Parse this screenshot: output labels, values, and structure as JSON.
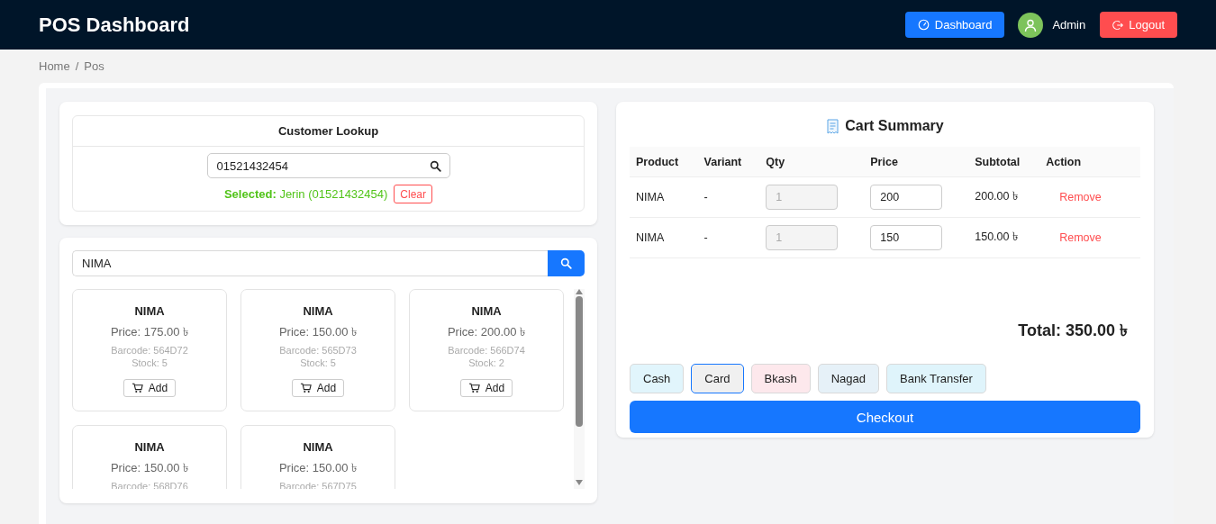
{
  "header": {
    "title": "POS Dashboard",
    "dashboard_button": "Dashboard",
    "user": "Admin",
    "logout_button": "Logout"
  },
  "breadcrumb": {
    "items": [
      "Home",
      "Pos"
    ],
    "separator": "/"
  },
  "customer_lookup": {
    "title": "Customer Lookup",
    "search_value": "01521432454",
    "selected_label": "Selected:",
    "selected_value": "Jerin (01521432454)",
    "clear_button": "Clear"
  },
  "product_search": {
    "value": "NIMA"
  },
  "products": [
    {
      "name": "NIMA",
      "price": "Price: 175.00 ৳",
      "barcode": "Barcode: 564D72",
      "stock": "Stock: 5",
      "add_button": "Add"
    },
    {
      "name": "NIMA",
      "price": "Price: 150.00 ৳",
      "barcode": "Barcode: 565D73",
      "stock": "Stock: 5",
      "add_button": "Add"
    },
    {
      "name": "NIMA",
      "price": "Price: 200.00 ৳",
      "barcode": "Barcode: 566D74",
      "stock": "Stock: 2",
      "add_button": "Add"
    },
    {
      "name": "NIMA",
      "price": "Price: 150.00 ৳",
      "barcode": "Barcode: 568D76"
    },
    {
      "name": "NIMA",
      "price": "Price: 150.00 ৳",
      "barcode": "Barcode: 567D75"
    }
  ],
  "cart": {
    "title": "Cart Summary",
    "columns": [
      "Product",
      "Variant",
      "Qty",
      "Price",
      "Subtotal",
      "Action"
    ],
    "rows": [
      {
        "product": "NIMA",
        "variant": "-",
        "qty": "1",
        "price": "200",
        "subtotal": "200.00 ৳",
        "action": "Remove"
      },
      {
        "product": "NIMA",
        "variant": "-",
        "qty": "1",
        "price": "150",
        "subtotal": "150.00 ৳",
        "action": "Remove"
      }
    ],
    "total": "Total: 350.00 ৳",
    "payment_methods": [
      {
        "label": "Cash",
        "color": "#e1f5fc",
        "selected": false
      },
      {
        "label": "Card",
        "color": "#f0f0f0",
        "selected": true
      },
      {
        "label": "Bkash",
        "color": "#fde8ec",
        "selected": false
      },
      {
        "label": "Nagad",
        "color": "#e6f1f8",
        "selected": false
      },
      {
        "label": "Bank Transfer",
        "color": "#dff4fb",
        "selected": false
      }
    ],
    "checkout_button": "Checkout"
  }
}
